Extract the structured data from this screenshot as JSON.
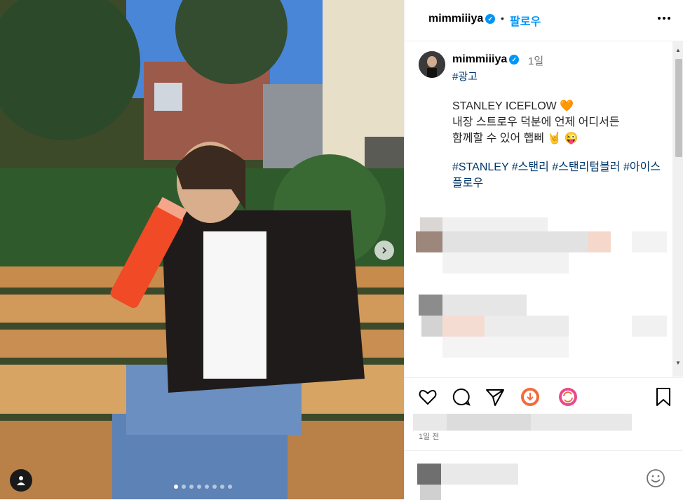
{
  "post": {
    "username": "mimmiiiya",
    "separator": "•",
    "follow_label": "팔로우",
    "time_ago": "1일",
    "ad_tag": "#광고",
    "caption_line1": "STANLEY ICEFLOW 🧡",
    "caption_line2": "내장 스트로우 덕분에 언제 어디서든",
    "caption_line3": "함께할 수 있어 햅삐 🤘 😜",
    "hashtags": "#STANLEY #스탠리 #스탠리텀블러 #아이스플로우",
    "date_label": "1일 전",
    "carousel": {
      "slides": 8,
      "active": 1
    }
  },
  "icons": {
    "verified": "verified-badge-icon",
    "more": "more-options-icon",
    "next": "chevron-right-icon",
    "user_tag": "user-tag-icon",
    "like": "heart-icon",
    "comment": "comment-icon",
    "share": "send-icon",
    "promo1": "download-badge-icon",
    "promo2": "refresh-badge-icon",
    "save": "bookmark-icon",
    "emoji": "emoji-icon"
  },
  "colors": {
    "accent": "#0095f6",
    "hashtag": "#00376b",
    "text": "#262626",
    "muted": "#737373"
  }
}
